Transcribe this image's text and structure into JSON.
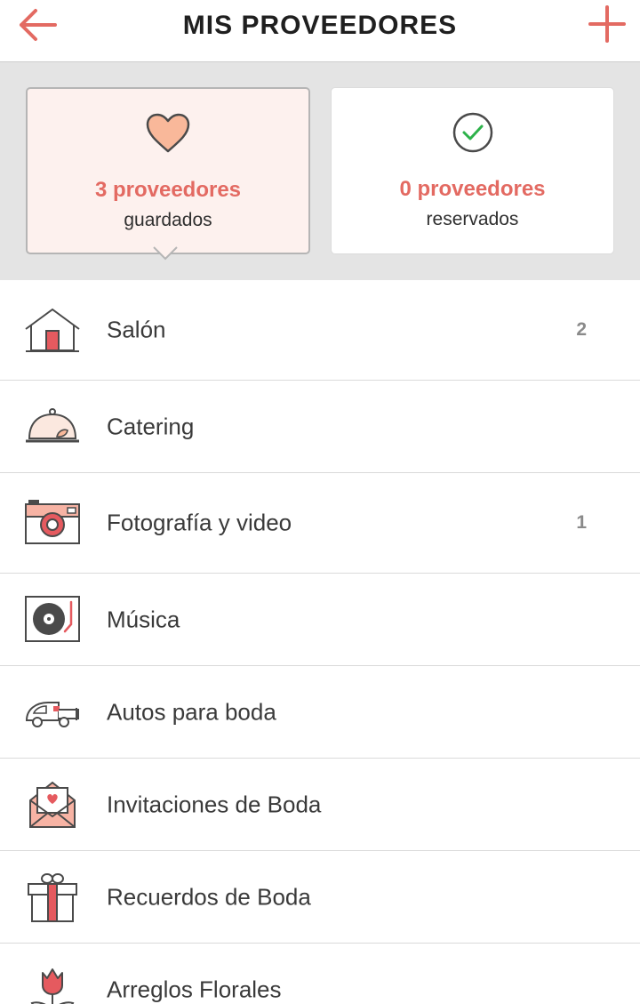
{
  "header": {
    "title": "MIS PROVEEDORES"
  },
  "summary": {
    "saved": {
      "count_label": "3 proveedores",
      "sub_label": "guardados"
    },
    "booked": {
      "count_label": "0 proveedores",
      "sub_label": "reservados"
    }
  },
  "categories": [
    {
      "label": "Salón",
      "count": "2"
    },
    {
      "label": "Catering",
      "count": ""
    },
    {
      "label": "Fotografía y video",
      "count": "1"
    },
    {
      "label": "Música",
      "count": ""
    },
    {
      "label": "Autos para boda",
      "count": ""
    },
    {
      "label": "Invitaciones de Boda",
      "count": ""
    },
    {
      "label": "Recuerdos de Boda",
      "count": ""
    },
    {
      "label": "Arreglos Florales",
      "count": ""
    }
  ],
  "colors": {
    "accent": "#e36a62",
    "check": "#2db24a",
    "card_saved_bg": "#fdf1ee"
  },
  "icons": [
    "arrow-left-icon",
    "plus-icon",
    "heart-icon",
    "check-circle-icon",
    "house-icon",
    "cloche-icon",
    "camera-icon",
    "turntable-icon",
    "car-icon",
    "envelope-icon",
    "gift-icon",
    "tulip-icon"
  ]
}
